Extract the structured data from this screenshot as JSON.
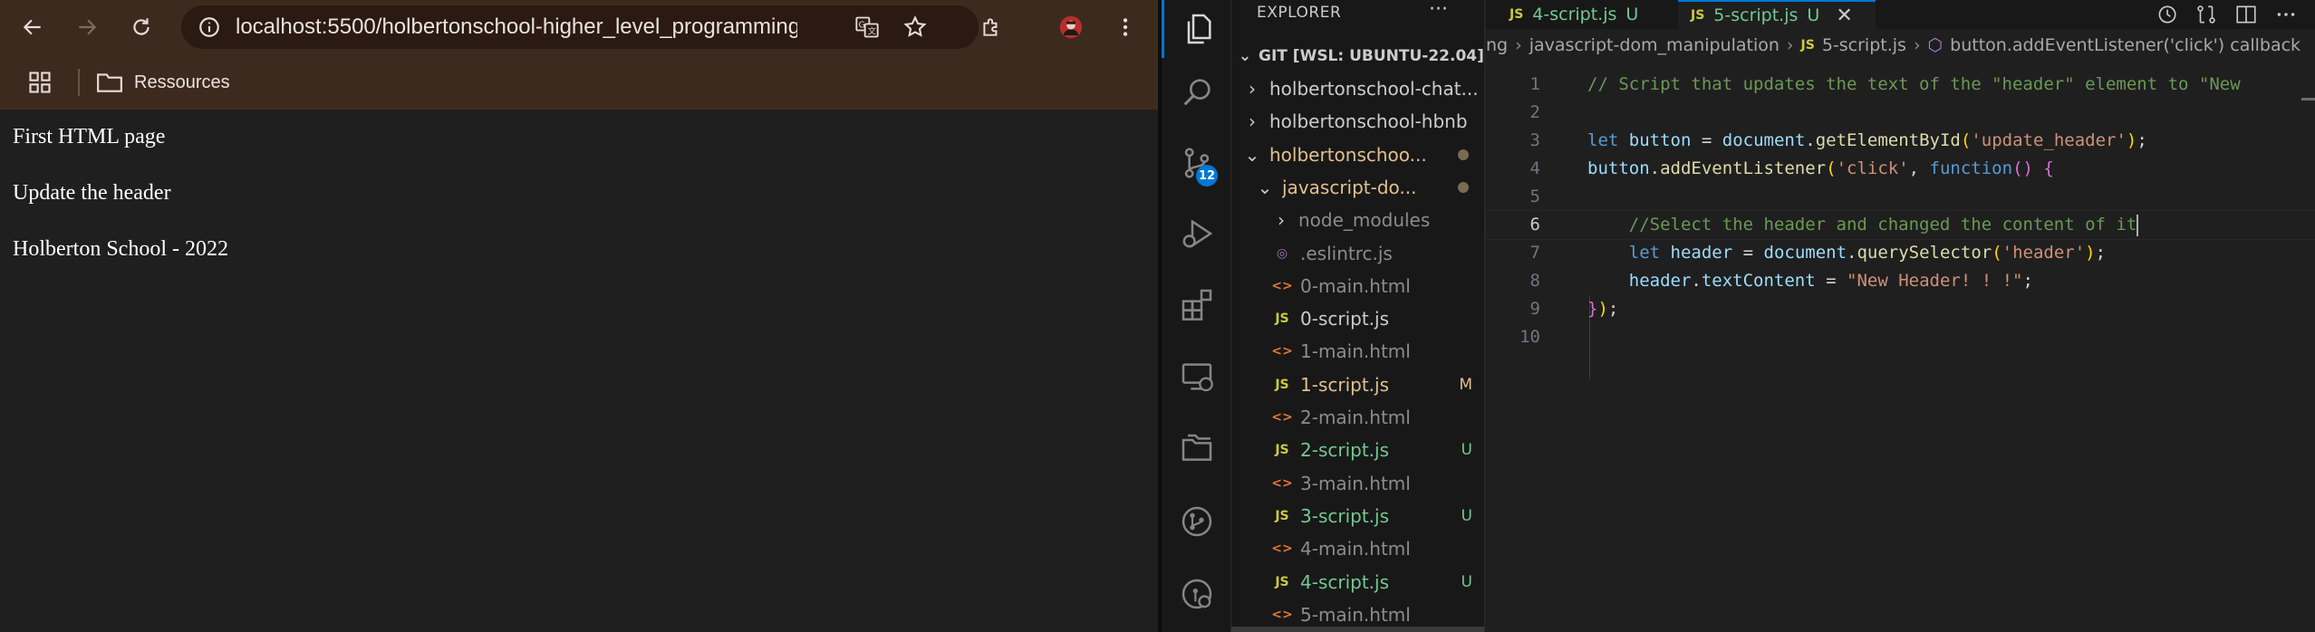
{
  "browser": {
    "url": "localhost:5500/holbertonschool-higher_level_programming/jav…",
    "bookmark_folder": "Ressources",
    "page_lines": [
      "First HTML page",
      "Update the header",
      "Holberton School - 2022"
    ],
    "icons": [
      "back-icon",
      "forward-icon",
      "reload-icon",
      "site-info-icon",
      "translate-icon",
      "star-icon",
      "extensions-icon",
      "avatar",
      "menu-icon",
      "apps-icon",
      "folder-icon"
    ]
  },
  "vscode": {
    "explorer_title": "EXPLORER",
    "explorer_more": "···",
    "section_title": "GIT [WSL: UBUNTU-22.04]",
    "scm_badge": "12",
    "tree": [
      {
        "label": "holbertonschool-chat...",
        "kind": "folder",
        "expanded": false,
        "indent": 0,
        "status": "",
        "color": "default"
      },
      {
        "label": "holbertonschool-hbnb",
        "kind": "folder",
        "expanded": false,
        "indent": 0,
        "status": "",
        "color": "default"
      },
      {
        "label": "holbertonschoo...",
        "kind": "folder",
        "expanded": true,
        "indent": 0,
        "status": "dot",
        "color": "mod"
      },
      {
        "label": "javascript-do...",
        "kind": "folder",
        "expanded": true,
        "indent": 1,
        "status": "dot",
        "color": "mod"
      },
      {
        "label": "node_modules",
        "kind": "folder",
        "expanded": false,
        "indent": 2,
        "status": "",
        "color": "ignored"
      },
      {
        "label": ".eslintrc.js",
        "kind": "eslint",
        "indent": 2,
        "status": "",
        "color": "ignored"
      },
      {
        "label": "0-main.html",
        "kind": "html",
        "indent": 2,
        "status": "",
        "color": "ignored"
      },
      {
        "label": "0-script.js",
        "kind": "js",
        "indent": 2,
        "status": "",
        "color": "default"
      },
      {
        "label": "1-main.html",
        "kind": "html",
        "indent": 2,
        "status": "",
        "color": "ignored"
      },
      {
        "label": "1-script.js",
        "kind": "js",
        "indent": 2,
        "status": "M",
        "color": "mod"
      },
      {
        "label": "2-main.html",
        "kind": "html",
        "indent": 2,
        "status": "",
        "color": "ignored"
      },
      {
        "label": "2-script.js",
        "kind": "js",
        "indent": 2,
        "status": "U",
        "color": "untracked"
      },
      {
        "label": "3-main.html",
        "kind": "html",
        "indent": 2,
        "status": "",
        "color": "ignored"
      },
      {
        "label": "3-script.js",
        "kind": "js",
        "indent": 2,
        "status": "U",
        "color": "untracked"
      },
      {
        "label": "4-main.html",
        "kind": "html",
        "indent": 2,
        "status": "",
        "color": "ignored"
      },
      {
        "label": "4-script.js",
        "kind": "js",
        "indent": 2,
        "status": "U",
        "color": "untracked"
      },
      {
        "label": "5-main.html",
        "kind": "html",
        "indent": 2,
        "status": "",
        "color": "ignored"
      }
    ],
    "tabs": [
      {
        "icon": "JS",
        "label": "4-script.js",
        "status": "U",
        "active": false
      },
      {
        "icon": "JS",
        "label": "5-script.js",
        "status": "U",
        "active": true,
        "close": "✕"
      }
    ],
    "breadcrumbs": [
      "ng",
      "javascript-dom_manipulation",
      "5-script.js",
      "button.addEventListener('click') callback"
    ],
    "breadcrumb_icons": [
      "JS",
      "⬡"
    ],
    "cursor_line": 6,
    "code_lines": [
      [
        [
          "cmt",
          "// Script that updates the text of the \"header\" element to \"New"
        ]
      ],
      [],
      [
        [
          "kw",
          "let"
        ],
        [
          "plain",
          " "
        ],
        [
          "var",
          "button"
        ],
        [
          "plain",
          " = "
        ],
        [
          "var",
          "document"
        ],
        [
          "plain",
          "."
        ],
        [
          "fn",
          "getElementById"
        ],
        [
          "brk1",
          "("
        ],
        [
          "str",
          "'update_header'"
        ],
        [
          "brk1",
          ")"
        ],
        [
          "plain",
          ";"
        ]
      ],
      [
        [
          "var",
          "button"
        ],
        [
          "plain",
          "."
        ],
        [
          "fn",
          "addEventListener"
        ],
        [
          "brk1",
          "("
        ],
        [
          "str",
          "'click'"
        ],
        [
          "plain",
          ", "
        ],
        [
          "kw",
          "function"
        ],
        [
          "brk2",
          "()"
        ],
        [
          "plain",
          " "
        ],
        [
          "brk2",
          "{"
        ]
      ],
      [],
      [
        [
          "plain",
          "    "
        ],
        [
          "cmt",
          "//Select the header and changed the content of it"
        ]
      ],
      [
        [
          "plain",
          "    "
        ],
        [
          "kw",
          "let"
        ],
        [
          "plain",
          " "
        ],
        [
          "var",
          "header"
        ],
        [
          "plain",
          " = "
        ],
        [
          "var",
          "document"
        ],
        [
          "plain",
          "."
        ],
        [
          "fn",
          "querySelector"
        ],
        [
          "brk1",
          "("
        ],
        [
          "str",
          "'header'"
        ],
        [
          "brk1",
          ")"
        ],
        [
          "plain",
          ";"
        ]
      ],
      [
        [
          "plain",
          "    "
        ],
        [
          "var",
          "header"
        ],
        [
          "plain",
          "."
        ],
        [
          "var",
          "textContent"
        ],
        [
          "plain",
          " = "
        ],
        [
          "str",
          "\"New Header! ! !\""
        ],
        [
          "plain",
          ";"
        ]
      ],
      [
        [
          "brk2",
          "}"
        ],
        [
          "brk1",
          ")"
        ],
        [
          "plain",
          ";"
        ]
      ],
      []
    ]
  }
}
